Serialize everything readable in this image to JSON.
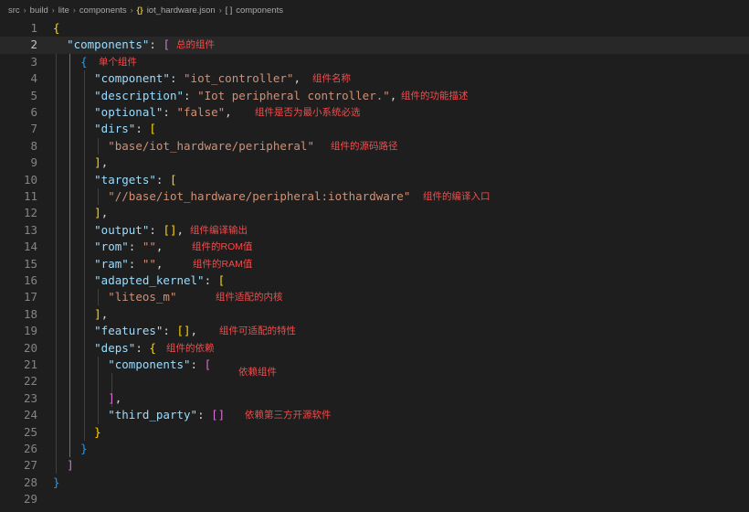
{
  "breadcrumb": {
    "items": [
      "src",
      "build",
      "lite",
      "components"
    ],
    "file_icon": "{}",
    "file": "iot_hardware.json",
    "symbol_icon": "[ ]",
    "symbol": "components"
  },
  "editor": {
    "line_numbers": [
      "1",
      "2",
      "3",
      "4",
      "5",
      "6",
      "7",
      "8",
      "9",
      "10",
      "11",
      "12",
      "13",
      "14",
      "15",
      "16",
      "17",
      "18",
      "19",
      "20",
      "21",
      "22",
      "23",
      "24",
      "25",
      "26",
      "27",
      "28",
      "29"
    ],
    "current_line": 2,
    "code": {
      "components_key": "\"components\"",
      "component_key": "\"component\"",
      "component_val": "\"iot_controller\"",
      "description_key": "\"description\"",
      "description_val": "\"Iot peripheral controller.\"",
      "optional_key": "\"optional\"",
      "optional_val": "\"false\"",
      "dirs_key": "\"dirs\"",
      "dirs_val": "\"base/iot_hardware/peripheral\"",
      "targets_key": "\"targets\"",
      "targets_val": "\"//base/iot_hardware/peripheral:iothardware\"",
      "output_key": "\"output\"",
      "rom_key": "\"rom\"",
      "rom_val": "\"\"",
      "ram_key": "\"ram\"",
      "ram_val": "\"\"",
      "adapted_kernel_key": "\"adapted_kernel\"",
      "adapted_kernel_val": "\"liteos_m\"",
      "features_key": "\"features\"",
      "deps_key": "\"deps\"",
      "deps_components_key": "\"components\"",
      "third_party_key": "\"third_party\""
    },
    "annotations": {
      "components": "总的组件",
      "single": "单个组件",
      "component": "组件名称",
      "description": "组件的功能描述",
      "optional": "组件是否为最小系统必选",
      "dirs": "组件的源码路径",
      "targets": "组件的编译入口",
      "output": "组件编译输出",
      "rom": "组件的ROM值",
      "ram": "组件的RAM值",
      "adapted_kernel": "组件适配的内核",
      "features": "组件可适配的特性",
      "deps": "组件的依赖",
      "deps_components": "依赖组件",
      "third_party": "依赖第三方开源软件"
    }
  },
  "colors": {
    "background": "#1e1e1e",
    "current_line": "#282828",
    "key": "#9cdcfe",
    "string": "#ce9178",
    "bracket_level1": "#ffd700",
    "bracket_level2": "#da70d6",
    "bracket_level3": "#179fff",
    "annotation": "#f14c4c"
  }
}
